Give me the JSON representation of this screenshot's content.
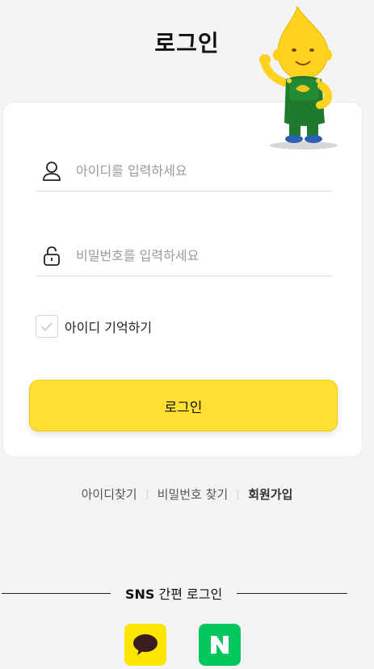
{
  "page": {
    "title": "로그인"
  },
  "form": {
    "id_placeholder": "아이디를 입력하세요",
    "pw_placeholder": "비밀번호를 입력하세요",
    "remember_label": "아이디 기억하기",
    "remember_checked": false,
    "login_button": "로그인"
  },
  "links": {
    "find_id": "아이디찾기",
    "find_pw": "비밀번호 찾기",
    "signup": "회원가입"
  },
  "sns": {
    "title_bold": "SNS",
    "title_rest": " 간편 로그인",
    "providers": [
      {
        "name": "kakao",
        "icon": "kakao-talk-icon",
        "color": "#fee500"
      },
      {
        "name": "naver",
        "icon": "naver-n-icon",
        "color": "#03c75a"
      }
    ]
  },
  "colors": {
    "accent": "#ffe033",
    "background": "#f4f4f4"
  }
}
